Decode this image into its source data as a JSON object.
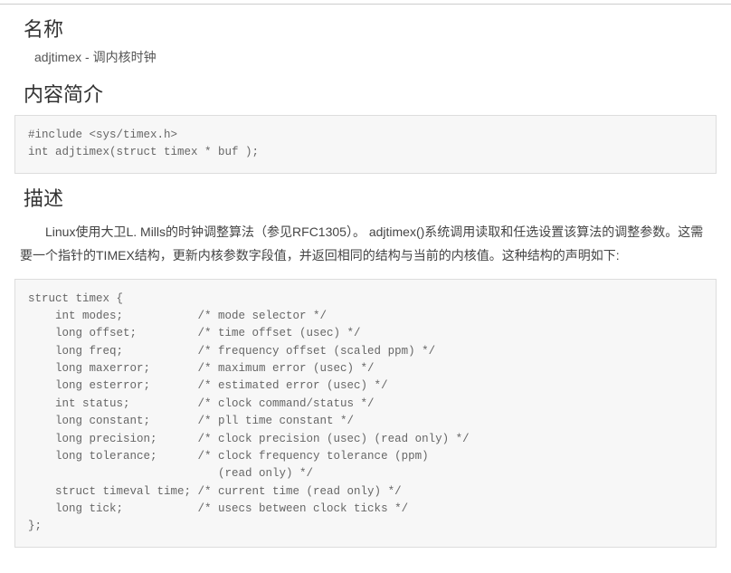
{
  "sections": {
    "name": {
      "heading": "名称",
      "text": "adjtimex - 调内核时钟"
    },
    "synopsis": {
      "heading": "内容简介",
      "code": "#include <sys/timex.h>\nint adjtimex(struct timex * buf );"
    },
    "description": {
      "heading": "描述",
      "para": "Linux使用大卫L. Mills的时钟调整算法（参见RFC1305）。 adjtimex()系统调用读取和任选设置该算法的调整参数。这需要一个指针的TIMEX结构，更新内核参数字段值，并返回相同的结构与当前的内核值。这种结构的声明如下:",
      "code": "struct timex {\n    int modes;           /* mode selector */\n    long offset;         /* time offset (usec) */\n    long freq;           /* frequency offset (scaled ppm) */\n    long maxerror;       /* maximum error (usec) */\n    long esterror;       /* estimated error (usec) */\n    int status;          /* clock command/status */\n    long constant;       /* pll time constant */\n    long precision;      /* clock precision (usec) (read only) */\n    long tolerance;      /* clock frequency tolerance (ppm)\n                            (read only) */\n    struct timeval time; /* current time (read only) */\n    long tick;           /* usecs between clock ticks */\n};"
    }
  }
}
